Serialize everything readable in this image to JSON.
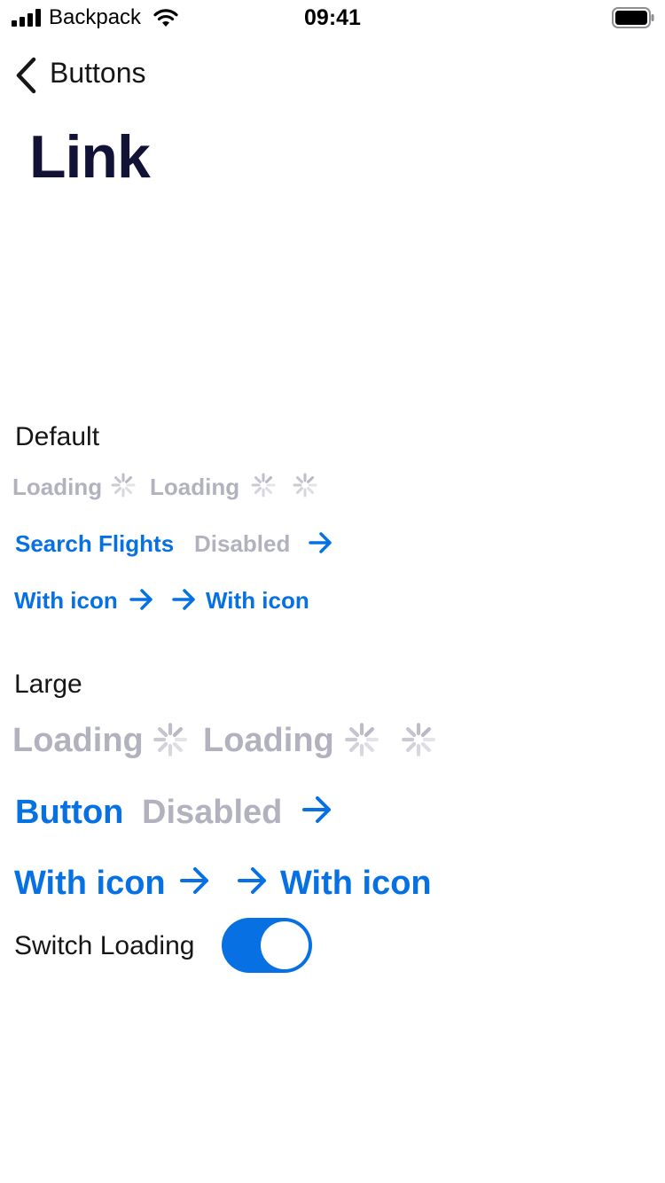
{
  "status_bar": {
    "carrier": "Backpack",
    "time": "09:41"
  },
  "nav": {
    "back_label": "Buttons"
  },
  "title": "Link",
  "sections": {
    "default": {
      "label": "Default",
      "loading_1": "Loading",
      "loading_2": "Loading",
      "search_flights": "Search Flights",
      "disabled": "Disabled",
      "with_icon_trailing": "With icon",
      "with_icon_leading": "With icon"
    },
    "large": {
      "label": "Large",
      "loading_1": "Loading",
      "loading_2": "Loading",
      "button": "Button",
      "disabled": "Disabled",
      "with_icon_trailing": "With icon",
      "with_icon_leading": "With icon"
    }
  },
  "switch": {
    "label": "Switch Loading",
    "on": true
  },
  "colors": {
    "link": "#0770e3",
    "muted": "#b2b2bf",
    "title": "#111236"
  }
}
